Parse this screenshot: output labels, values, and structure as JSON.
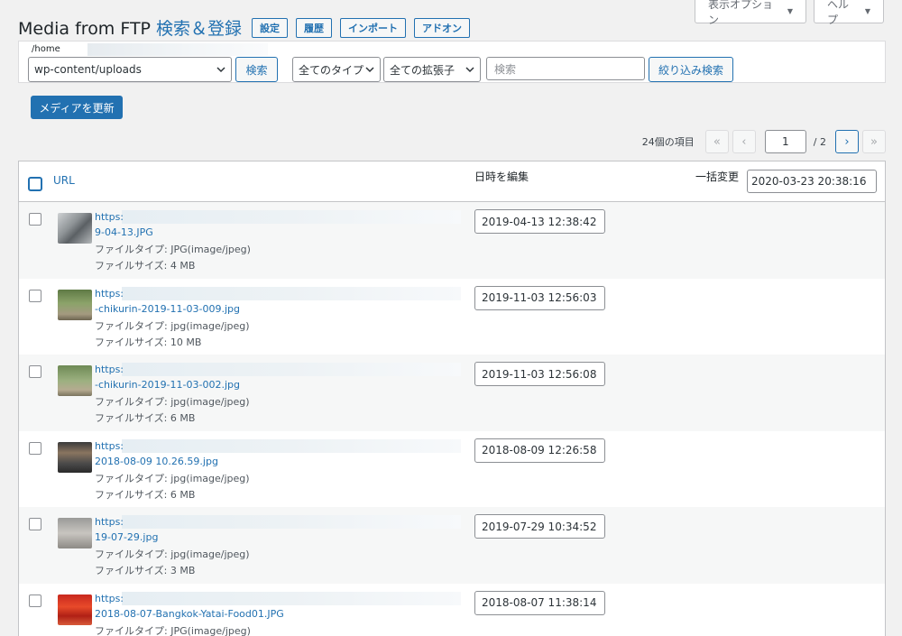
{
  "screen_options": {
    "options_label": "表示オプション",
    "help_label": "ヘルプ"
  },
  "header": {
    "title": "Media from FTP",
    "subtitle": "検索＆登録",
    "tabs": [
      "設定",
      "履歴",
      "インポート",
      "アドオン"
    ]
  },
  "filter": {
    "path_label": "/home",
    "directory": "wp-content/uploads",
    "search_button": "検索",
    "type_select": "全てのタイプ",
    "ext_select": "全ての拡張子",
    "search_placeholder": "検索",
    "refine_button": "絞り込み検索"
  },
  "update_button": "メディアを更新",
  "pagination": {
    "count": "24個の項目",
    "first": "«",
    "prev": "‹",
    "current": "1",
    "total": "/ 2",
    "next": "›",
    "last": "»"
  },
  "table": {
    "headers": {
      "url": "URL",
      "date": "日時を編集",
      "bulk": "一括変更"
    },
    "bulk_date": "2020-03-23 20:38:16",
    "rows": [
      {
        "url_prefix": "https:",
        "filename": "9-04-13.JPG",
        "type": "ファイルタイプ: JPG(image/jpeg)",
        "size": "ファイルサイズ: 4 MB",
        "date": "2019-04-13 12:38:42",
        "thumb": "hdd"
      },
      {
        "url_prefix": "https:",
        "filename": "-chikurin-2019-11-03-009.jpg",
        "type": "ファイルタイプ: jpg(image/jpeg)",
        "size": "ファイルサイズ: 10 MB",
        "date": "2019-11-03 12:56:03",
        "thumb": "bamboo"
      },
      {
        "url_prefix": "https:",
        "filename": "-chikurin-2019-11-03-002.jpg",
        "type": "ファイルタイプ: jpg(image/jpeg)",
        "size": "ファイルサイズ: 6 MB",
        "date": "2019-11-03 12:56:08",
        "thumb": "bamboo2"
      },
      {
        "url_prefix": "https:",
        "filename": "2018-08-09 10.26.59.jpg",
        "type": "ファイルタイプ: jpg(image/jpeg)",
        "size": "ファイルサイズ: 6 MB",
        "date": "2018-08-09 12:26:58",
        "thumb": "station"
      },
      {
        "url_prefix": "https:",
        "filename": "19-07-29.jpg",
        "type": "ファイルタイプ: jpg(image/jpeg)",
        "size": "ファイルサイズ: 3 MB",
        "date": "2019-07-29 10:34:52",
        "thumb": "dog"
      },
      {
        "url_prefix": "https:",
        "filename": "2018-08-07-Bangkok-Yatai-Food01.JPG",
        "type": "ファイルタイプ: JPG(image/jpeg)",
        "size": "",
        "date": "2018-08-07 11:38:14",
        "thumb": "food"
      }
    ]
  }
}
